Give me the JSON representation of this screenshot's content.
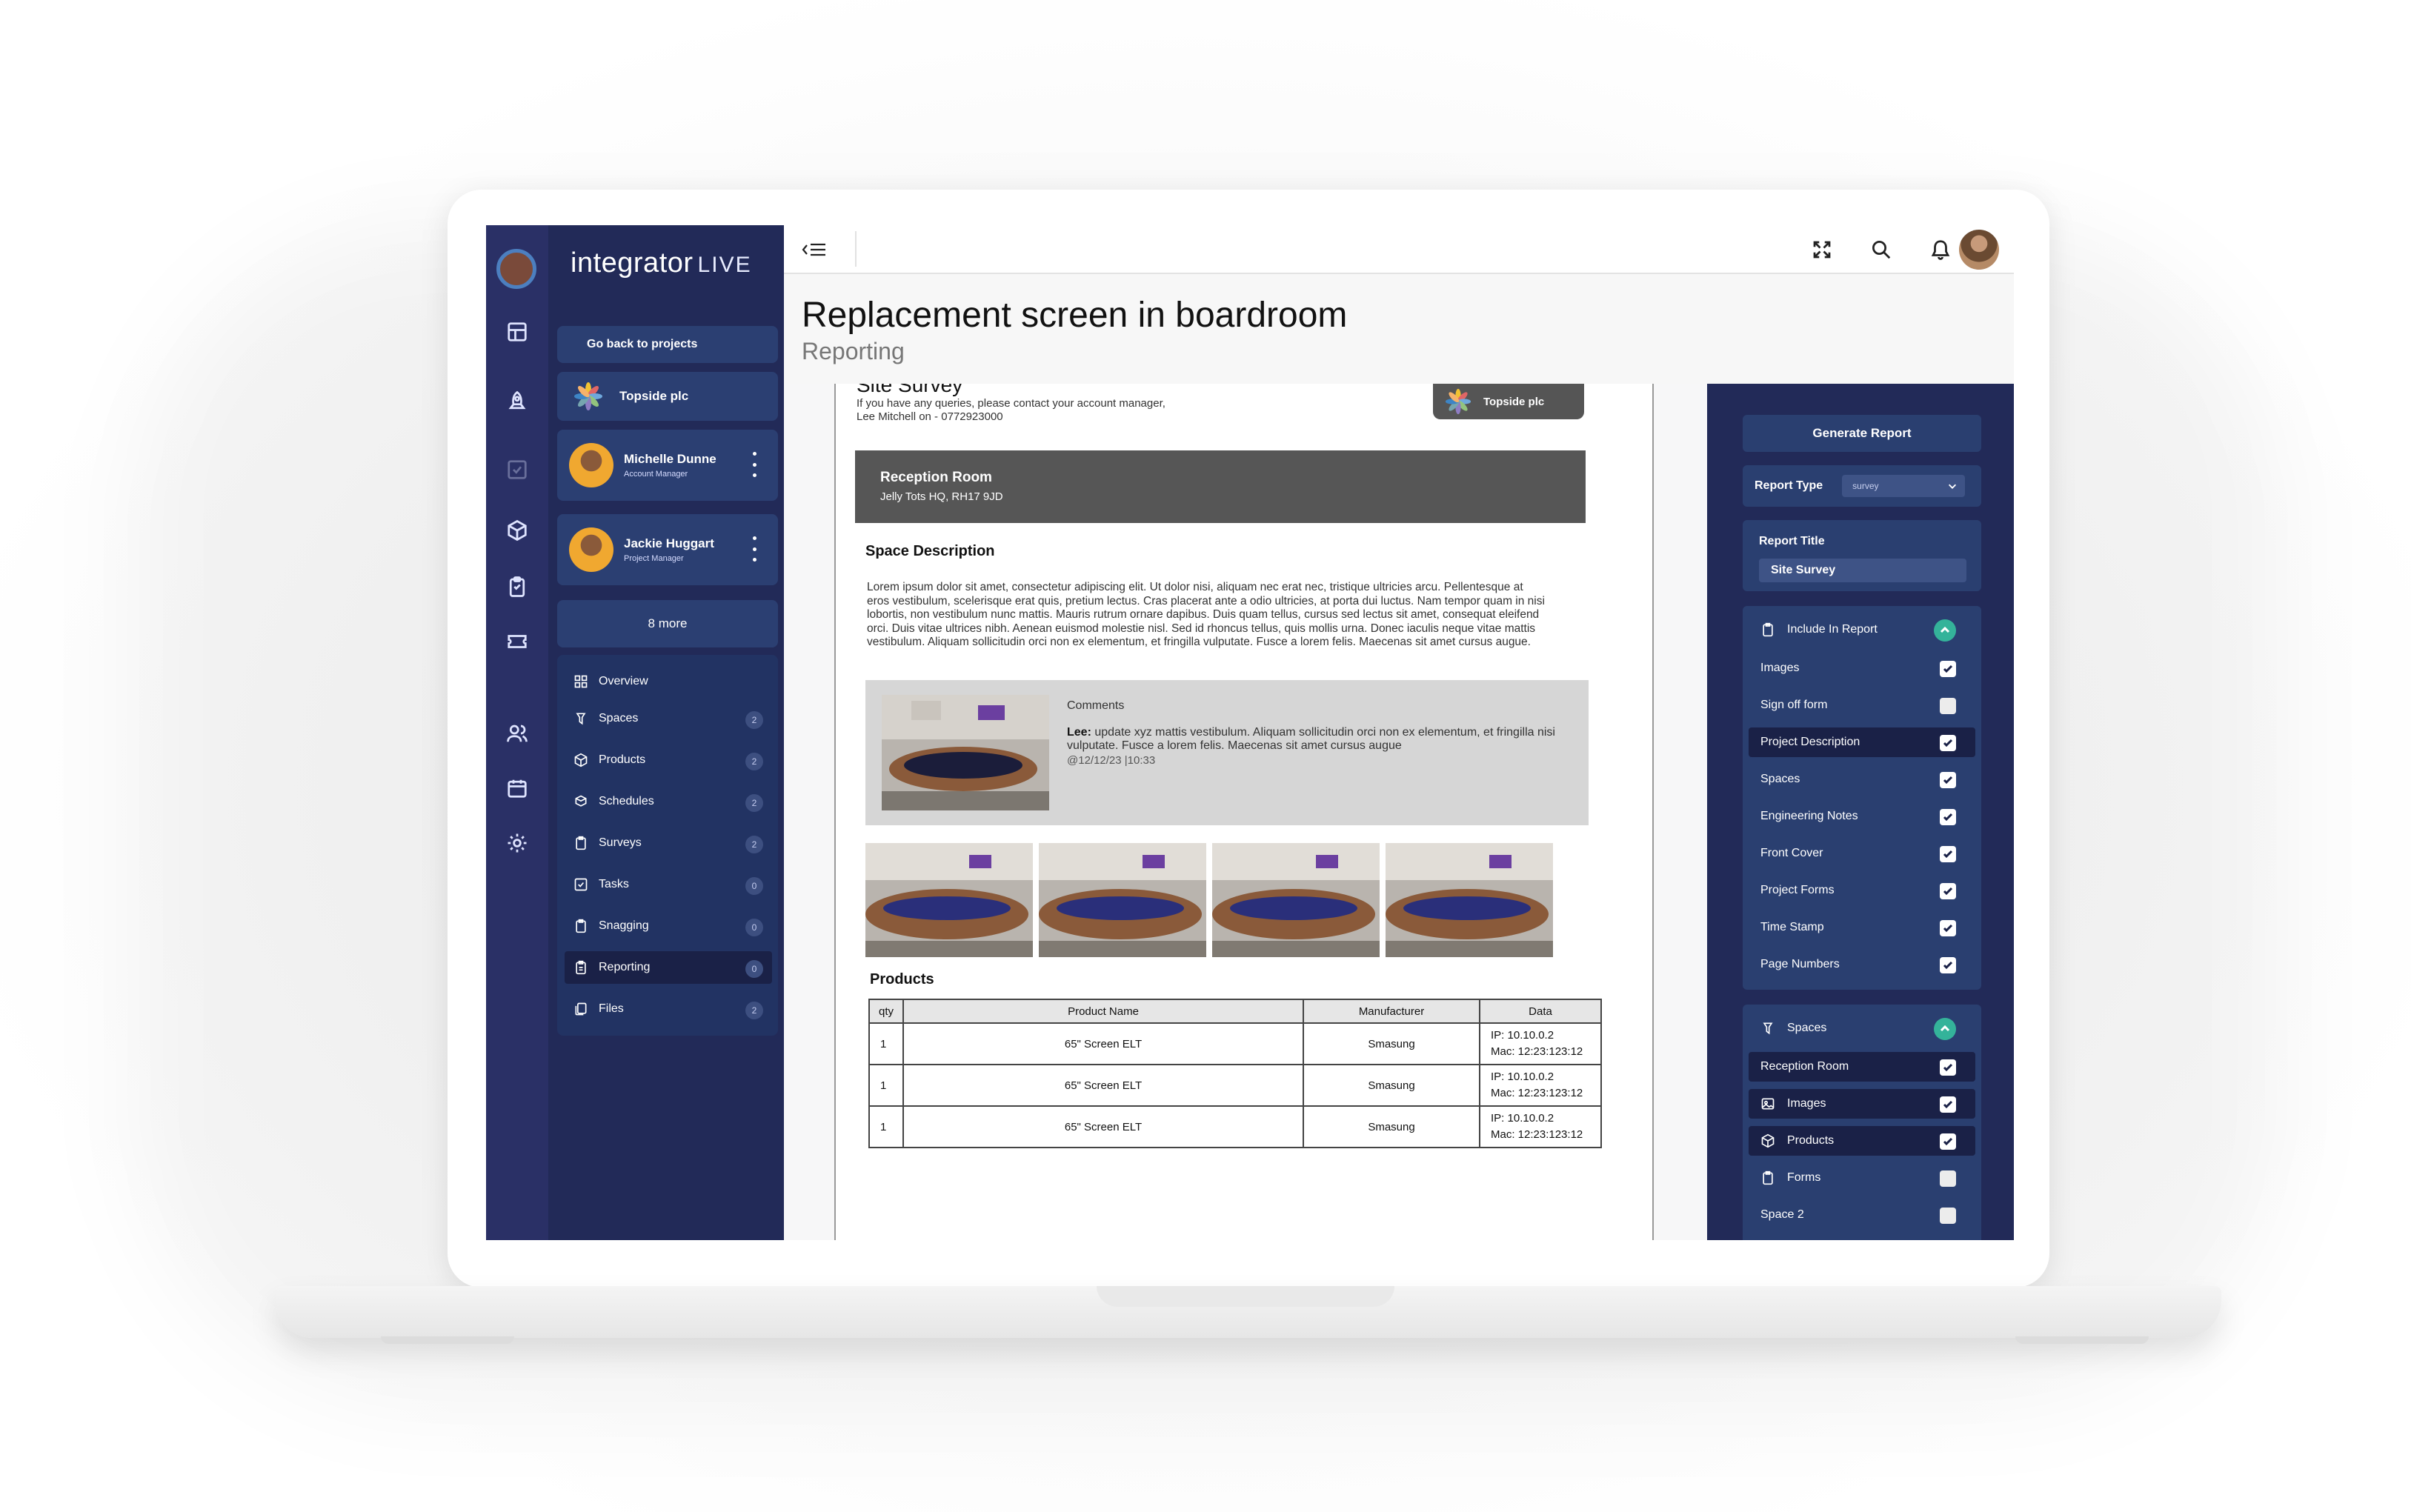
{
  "app": {
    "brand": "integrator",
    "brand_suffix": "LIVE",
    "colors": {
      "rail": "#2a3066",
      "panel": "#222a58",
      "card": "#2b3f72",
      "accent": "#34b39a"
    }
  },
  "page": {
    "title": "Replacement screen in boardroom",
    "subtitle": "Reporting"
  },
  "leftpanel": {
    "back_label": "Go back to projects",
    "client": "Topside plc",
    "people": [
      {
        "name": "Michelle Dunne",
        "role": "Account Manager"
      },
      {
        "name": "Jackie Huggart",
        "role": "Project Manager"
      }
    ],
    "more_label": "8 more",
    "nav": [
      {
        "label": "Overview",
        "icon": "grid-icon",
        "badge": ""
      },
      {
        "label": "Spaces",
        "icon": "pin-icon",
        "badge": "2"
      },
      {
        "label": "Products",
        "icon": "box-icon",
        "badge": "2"
      },
      {
        "label": "Schedules",
        "icon": "boxes-icon",
        "badge": "2"
      },
      {
        "label": "Surveys",
        "icon": "clipboard-icon",
        "badge": "2"
      },
      {
        "label": "Tasks",
        "icon": "check-square-icon",
        "badge": "0"
      },
      {
        "label": "Snagging",
        "icon": "clipboard-icon",
        "badge": "0"
      },
      {
        "label": "Reporting",
        "icon": "report-icon",
        "badge": "0"
      },
      {
        "label": "Files",
        "icon": "files-icon",
        "badge": "2"
      }
    ]
  },
  "doc": {
    "report_title": "Site Survey",
    "contact_line1": "If you have any queries, please contact your account manager,",
    "contact_line2": "Lee Mitchell on - 0772923000",
    "client_chip": "Topside plc",
    "room_name": "Reception Room",
    "room_address": "Jelly Tots HQ, RH17 9JD",
    "space_desc_heading": "Space Description",
    "space_desc_text": "Lorem ipsum dolor sit amet, consectetur adipiscing elit. Ut dolor nisi, aliquam nec erat nec, tristique ultricies arcu. Pellentesque at eros vestibulum, scelerisque erat quis, pretium lectus. Cras placerat ante a odio ultricies, at porta dui luctus. Nam tempor quam in nisi lobortis, non vestibulum nunc mattis. Mauris rutrum ornare dapibus. Duis quam tellus, cursus sed lectus sit amet, consequat eleifend orci. Duis vitae ultrices nibh. Aenean euismod molestie nisl. Sed id rhoncus tellus, quis mollis urna. Donec iaculis neque vitae mattis vestibulum. Aliquam sollicitudin orci non ex elementum, et fringilla vulputate. Fusce a lorem felis. Maecenas sit amet cursus augue.",
    "comments_heading": "Comments",
    "comment_author": "Lee:",
    "comment_text": " update xyz mattis vestibulum. Aliquam sollicitudin orci non ex elementum, et fringilla nisi vulputate. Fusce a lorem felis. Maecenas sit amet cursus augue",
    "comment_date": "@12/12/23 |10:33",
    "products_heading": "Products",
    "table_headers": [
      "qty",
      "Product Name",
      "Manufacturer",
      "Data"
    ],
    "products": [
      {
        "qty": "1",
        "name": "65\" Screen ELT",
        "manufacturer": "Smasung",
        "ip": "IP: 10.10.0.2",
        "mac": "Mac: 12:23:123:12"
      },
      {
        "qty": "1",
        "name": "65\" Screen ELT",
        "manufacturer": "Smasung",
        "ip": "IP: 10.10.0.2",
        "mac": "Mac: 12:23:123:12"
      },
      {
        "qty": "1",
        "name": "65\" Screen ELT",
        "manufacturer": "Smasung",
        "ip": "IP: 10.10.0.2",
        "mac": "Mac: 12:23:123:12"
      }
    ]
  },
  "rightpanel": {
    "generate_label": "Generate Report",
    "type_label": "Report Type",
    "type_value": "survey",
    "title_label": "Report Title",
    "title_value": "Site Survey",
    "include_heading": "Include In Report",
    "include_items": [
      {
        "label": "Images",
        "checked": true,
        "highlight": false
      },
      {
        "label": "Sign off form",
        "checked": false,
        "highlight": false
      },
      {
        "label": "Project Description",
        "checked": true,
        "highlight": true
      },
      {
        "label": "Spaces",
        "checked": true,
        "highlight": false
      },
      {
        "label": "Engineering Notes",
        "checked": true,
        "highlight": false
      },
      {
        "label": "Front Cover",
        "checked": true,
        "highlight": false
      },
      {
        "label": "Project Forms",
        "checked": true,
        "highlight": false
      },
      {
        "label": "Time Stamp",
        "checked": true,
        "highlight": false
      },
      {
        "label": "Page Numbers",
        "checked": true,
        "highlight": false
      }
    ],
    "spaces_heading": "Spaces",
    "space_items": [
      {
        "label": "Reception Room",
        "checked": true,
        "highlight": true,
        "icon": ""
      },
      {
        "label": "Images",
        "checked": true,
        "highlight": true,
        "icon": "image-icon"
      },
      {
        "label": "Products",
        "checked": true,
        "highlight": true,
        "icon": "box-icon"
      },
      {
        "label": "Forms",
        "checked": false,
        "highlight": false,
        "icon": "clipboard-icon"
      },
      {
        "label": "Space 2",
        "checked": false,
        "highlight": false,
        "icon": ""
      }
    ]
  }
}
